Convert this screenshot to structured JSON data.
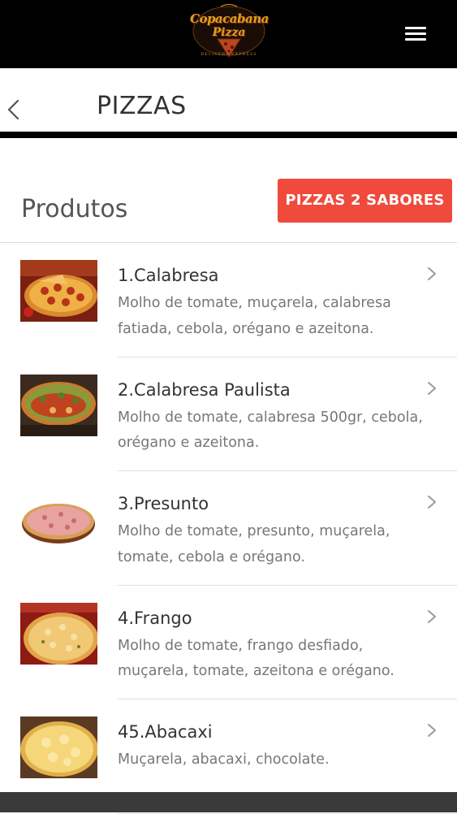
{
  "header": {
    "logo": {
      "line1": "Copacabana",
      "line2": "Pizza",
      "line3": "DELIVERY EXPRESS"
    },
    "menu_icon": "hamburger-icon"
  },
  "title_bar": {
    "back_icon": "chevron-left-icon",
    "title": "PIZZAS"
  },
  "products_header": {
    "title": "Produtos",
    "two_flavors_label": "PIZZAS 2 SABORES"
  },
  "colors": {
    "accent": "#ef4a3c",
    "topbar": "#000000",
    "logo_gold": "#e0a11d"
  },
  "products": [
    {
      "name": "1.Calabresa",
      "description": "Molho de tomate, muçarela, calabresa fatiada, cebola, orégano e azeitona.",
      "icon": "chevron-right-icon"
    },
    {
      "name": "2.Calabresa Paulista",
      "description": "Molho de tomate, calabresa 500gr, cebola, orégano e azeitona.",
      "icon": "chevron-right-icon"
    },
    {
      "name": "3.Presunto",
      "description": "Molho de tomate, presunto, muçarela, tomate, cebola e orégano.",
      "icon": "chevron-right-icon"
    },
    {
      "name": "4.Frango",
      "description": "Molho de tomate, frango desfiado, muçarela, tomate, azeitona e orégano.",
      "icon": "chevron-right-icon"
    },
    {
      "name": "45.Abacaxi",
      "description": "Muçarela, abacaxi, chocolate.",
      "icon": "chevron-right-icon"
    }
  ]
}
